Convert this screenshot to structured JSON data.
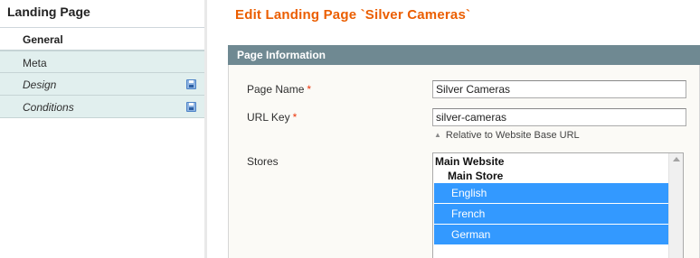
{
  "sidebar": {
    "title": "Landing Page",
    "tabs": [
      {
        "label": "General"
      },
      {
        "label": "Meta"
      },
      {
        "label": "Design",
        "icon": "save-icon"
      },
      {
        "label": "Conditions",
        "icon": "save-icon"
      }
    ]
  },
  "main": {
    "title": "Edit Landing Page `Silver Cameras`",
    "fieldset": {
      "header": "Page Information",
      "page_name": {
        "label": "Page Name",
        "required_mark": "*",
        "value": "Silver Cameras"
      },
      "url_key": {
        "label": "URL Key",
        "required_mark": "*",
        "value": "silver-cameras",
        "note": "Relative to Website Base URL"
      },
      "stores": {
        "label": "Stores",
        "website": "Main Website",
        "store": "Main Store",
        "options": [
          "English",
          "French",
          "German"
        ]
      }
    }
  },
  "colors": {
    "title_accent": "#eb5e00",
    "header_bg": "#6f8992",
    "tab_bg": "#e1efee",
    "selected_option": "#3399ff",
    "required": "#eb340a"
  }
}
